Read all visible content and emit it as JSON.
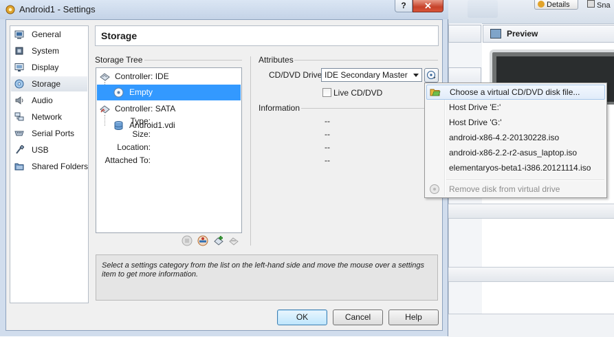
{
  "dialog": {
    "title": "Android1 - Settings",
    "help_button": "?",
    "close_button": "✕",
    "page_title": "Storage"
  },
  "background_window": {
    "details_button": "Details",
    "snapshots_label": "Sna",
    "preview_label": "Preview"
  },
  "categories": [
    {
      "label": "General",
      "icon": "general-icon"
    },
    {
      "label": "System",
      "icon": "system-chip-icon"
    },
    {
      "label": "Display",
      "icon": "display-monitor-icon"
    },
    {
      "label": "Storage",
      "icon": "storage-disk-icon",
      "selected": true
    },
    {
      "label": "Audio",
      "icon": "speaker-icon"
    },
    {
      "label": "Network",
      "icon": "network-icon"
    },
    {
      "label": "Serial Ports",
      "icon": "serial-port-icon"
    },
    {
      "label": "USB",
      "icon": "usb-icon"
    },
    {
      "label": "Shared Folders",
      "icon": "shared-folder-icon"
    }
  ],
  "storage_tree": {
    "label": "Storage Tree",
    "items": [
      {
        "label": "Controller: IDE",
        "icon": "ide-controller-icon",
        "level": 0
      },
      {
        "label": "Empty",
        "icon": "cd-disk-icon",
        "level": 1,
        "selected": true
      },
      {
        "label": "Controller: SATA",
        "icon": "sata-controller-icon",
        "level": 0
      },
      {
        "label": "Android1.vdi",
        "icon": "hard-disk-icon",
        "level": 1
      }
    ],
    "toolbar": [
      "add-attachment-icon",
      "add-controller-icon",
      "add-controller-plus-icon",
      "remove-controller-icon"
    ]
  },
  "attributes": {
    "label": "Attributes",
    "cd_drive_label": "CD/DVD Drive:",
    "cd_drive_value": "IDE Secondary Master",
    "live_cd_label": "Live CD/DVD",
    "live_cd_checked": false
  },
  "information": {
    "label": "Information",
    "rows": [
      {
        "key": "Type:",
        "value": "--"
      },
      {
        "key": "Size:",
        "value": "--"
      },
      {
        "key": "Location:",
        "value": "--"
      },
      {
        "key": "Attached To:",
        "value": "--"
      }
    ]
  },
  "help_text": "Select a settings category from the list on the left-hand side and move the mouse over a settings item to get more information.",
  "buttons": {
    "ok": "OK",
    "cancel": "Cancel",
    "help": "Help"
  },
  "menu": {
    "items": [
      {
        "label": "Choose a virtual CD/DVD disk file...",
        "icon": "open-folder-icon",
        "highlighted": true
      },
      {
        "label": "Host Drive 'E:'"
      },
      {
        "label": "Host Drive 'G:'"
      },
      {
        "label": "android-x86-4.2-20130228.iso"
      },
      {
        "label": "android-x86-2.2-r2-asus_laptop.iso"
      },
      {
        "label": "elementaryos-beta1-i386.20121114.iso"
      },
      {
        "label": "Remove disk from virtual drive",
        "icon": "remove-disk-icon",
        "disabled": true
      }
    ]
  },
  "colors": {
    "selection": "#3399ff",
    "title_gradient_top": "#dbe6f4",
    "close_red": "#c6422a"
  }
}
